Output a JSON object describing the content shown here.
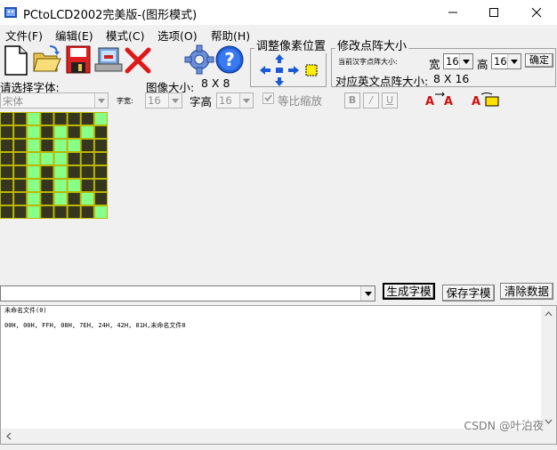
{
  "window": {
    "title": "PCtoLCD2002完美版-(图形模式)"
  },
  "menu": [
    "文件(F)",
    "编辑(E)",
    "模式(C)",
    "选项(O)",
    "帮助(H)"
  ],
  "toolbar_icons": [
    "new-file-icon",
    "open-folder-icon",
    "save-disk-icon",
    "lcd-output-icon",
    "delete-x-icon",
    "settings-gear-icon",
    "help-question-icon"
  ],
  "font_select": {
    "label": "请选择字体:",
    "value": "宋体"
  },
  "image_size": {
    "label": "图像大小:",
    "value": "8 X 8"
  },
  "font_width": {
    "label": "字宽:",
    "value": "16"
  },
  "font_height": {
    "label": "字高",
    "value": "16"
  },
  "proportional": {
    "label": "等比缩放",
    "checked": true
  },
  "format_buttons": [
    "B",
    "/",
    "U"
  ],
  "adjust_group": {
    "title": "调整像素位置"
  },
  "matrix_group": {
    "title": "修改点阵大小",
    "current_label": "当前汉字点阵大小:",
    "width_label": "宽",
    "width_value": "16",
    "height_label": "高",
    "height_value": "16",
    "confirm_label": "确定",
    "english_label": "对应英文点阵大小:",
    "english_value": "8 X 16"
  },
  "actions": {
    "generate": "生成字模",
    "save": "保存字模",
    "clear": "清除数据"
  },
  "output": {
    "line1": "未命名文件(0)",
    "line2": "00H, 00H, FFH, 08H, 7EH, 24H, 42H, 81H,未命名文件0"
  },
  "pixel_grid": {
    "rows": 8,
    "cols": 8,
    "on_color": "#88ff88",
    "off_color": "#353520",
    "line_color": "#b8b800",
    "bytes": [
      "00",
      "00",
      "FF",
      "08",
      "7E",
      "24",
      "42",
      "81"
    ]
  },
  "watermark": "CSDN @叶泊夜"
}
